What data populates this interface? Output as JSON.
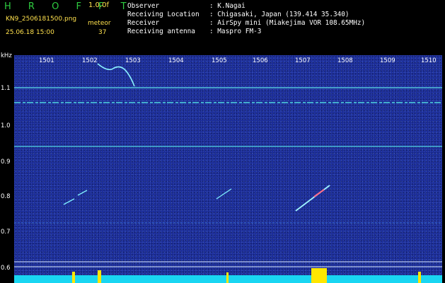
{
  "header": {
    "brand": "H R O F F T",
    "version": "1.0.0f",
    "filename": "KN9_2506181500.png",
    "meteor_label": "meteor",
    "datetime": "25.06.18 15:00",
    "meteor_count": "37",
    "info": [
      {
        "label": "Observer",
        "value": ": K.Nagai"
      },
      {
        "label": "Receiving Location",
        "value": ": Chigasaki, Japan (139.414 35.340)"
      },
      {
        "label": "Receiver",
        "value": ": AirSpy mini (Miakejima VOR 108.65MHz)"
      },
      {
        "label": "Receiving antenna",
        "value": ": Maspro FM-3"
      }
    ]
  },
  "spectrogram": {
    "y_unit": "kHz",
    "y_ticks": [
      "1.1",
      "1.0",
      "0.9",
      "0.8",
      "0.7",
      "0.6"
    ],
    "x_ticks": [
      "1501",
      "1502",
      "1503",
      "1504",
      "1505",
      "1506",
      "1507",
      "1508",
      "1509",
      "1510"
    ],
    "colors": {
      "background": "#1a2c9a",
      "carrier": "#5fe3e8",
      "echo": "#7ff0ff",
      "strong": "#ff6a8a",
      "baseline": "#19d6f2",
      "burst": "#ffe600"
    }
  }
}
